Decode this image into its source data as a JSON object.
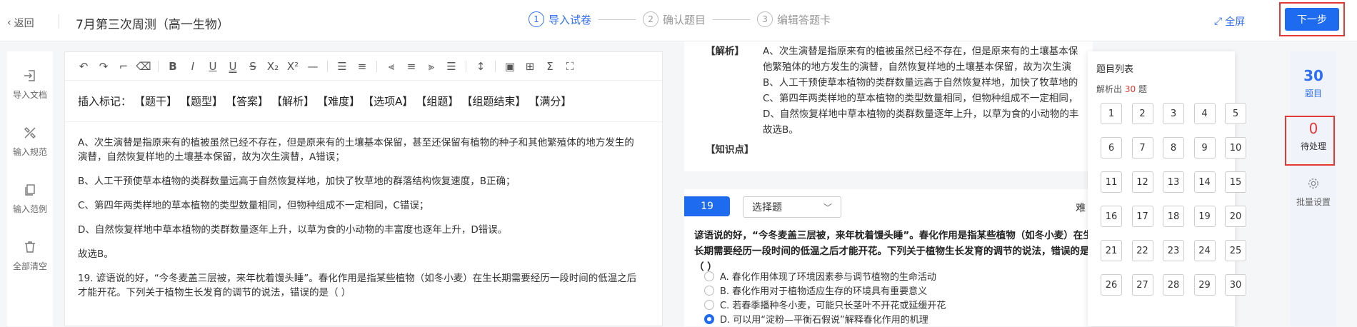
{
  "header": {
    "back_label": "返回",
    "title": "7月第三次周测（高一生物）",
    "steps": [
      {
        "num": "1",
        "label": "导入试卷",
        "active": true
      },
      {
        "num": "2",
        "label": "确认题目",
        "active": false
      },
      {
        "num": "3",
        "label": "编辑答题卡",
        "active": false
      }
    ],
    "fullscreen_label": "全屏",
    "next_label": "下一步"
  },
  "leftbar": {
    "items": [
      "导入文档",
      "输入规范",
      "输入范例",
      "全部清空"
    ]
  },
  "editor": {
    "insert_label": "插入标记：",
    "markers": [
      "【题干】",
      "【题型】",
      "【答案】",
      "【解析】",
      "【难度】",
      "【选项A】",
      "【组题】",
      "【组题结束】",
      "【满分】"
    ],
    "paragraphs": [
      "A、次生演替是指原来有的植被虽然已经不存在，但是原来有的土壤基本保留，甚至还保留有植物的种子和其他繁殖体的地方发生的演替，自然恢复样地的土壤基本保留，故为次生演替，A错误；",
      "B、人工干预使草本植物的类群数量远高于自然恢复样地，加快了牧草地的群落结构恢复速度，B正确；",
      "C、第四年两类样地的草本植物的类型数量相同，但物种组成不一定相同，C错误；",
      "D、自然恢复样地中草本植物的类群数量逐年上升，以草为食的小动物的丰富度也逐年上升，D错误。",
      "故选B。",
      "19. 谚语说的好，“今冬麦盖三层被，来年枕着馒头睡”。春化作用是指某些植物（如冬小麦）在生长期需要经历一段时间的低温之后才能开花。下列关于植物生长发育的调节的说法，错误的是（ ）"
    ]
  },
  "center": {
    "analysis_label": "【解析】",
    "analysis_lines": [
      "A、次生演替是指原来有的植被虽然已经不存在，但是原来有的土壤基本保",
      "他繁殖体的地方发生的演替，自然恢复样地的土壤基本保留，故为次生演",
      "B、人工干预使草本植物的类群数量远高于自然恢复样地，加快了牧草地的",
      "C、第四年两类样地的草本植物的类型数量相同，但物种组成不一定相同，",
      "D、自然恢复样地中草本植物的类群数量逐年上升，以草为食的小动物的丰",
      "故选B。"
    ],
    "knowledge_label": "【知识点】",
    "question": {
      "number": "19",
      "type": "选择题",
      "difficulty_label": "难",
      "stem": "谚语说的好，“今冬麦盖三层被，来年枕着馒头睡”。春化作用是指某些植物（如冬小麦）在生长期需要经历一段时间的低温之后才能开花。下列关于植物生长发育的调节的说法，错误的是（ ）",
      "options": [
        {
          "text": "A. 春化作用体现了环境因素参与调节植物的生命活动",
          "selected": false
        },
        {
          "text": "B. 春化作用对于植物适应生存的环境具有重要意义",
          "selected": false
        },
        {
          "text": "C. 若春季播种冬小麦，可能只长茎叶不开花或延缓开花",
          "selected": false
        },
        {
          "text": "D. 可以用“淀粉—平衡石假说”解释春化作用的机理",
          "selected": true
        }
      ]
    }
  },
  "question_list": {
    "title": "题目列表",
    "parsed_prefix": "解析出",
    "parsed_count": "30",
    "parsed_suffix": "题",
    "numbers": [
      "1",
      "2",
      "3",
      "4",
      "5",
      "6",
      "7",
      "8",
      "9",
      "10",
      "11",
      "12",
      "13",
      "14",
      "15",
      "16",
      "17",
      "18",
      "19",
      "20",
      "21",
      "22",
      "23",
      "24",
      "25",
      "26",
      "27",
      "28",
      "29",
      "30"
    ]
  },
  "rightbar": {
    "total_count": "30",
    "total_label": "题目",
    "pending_count": "0",
    "pending_label": "待处理",
    "batch_label": "批量设置"
  },
  "colors": {
    "primary": "#1f6bf0",
    "highlight_border": "#e53935"
  }
}
